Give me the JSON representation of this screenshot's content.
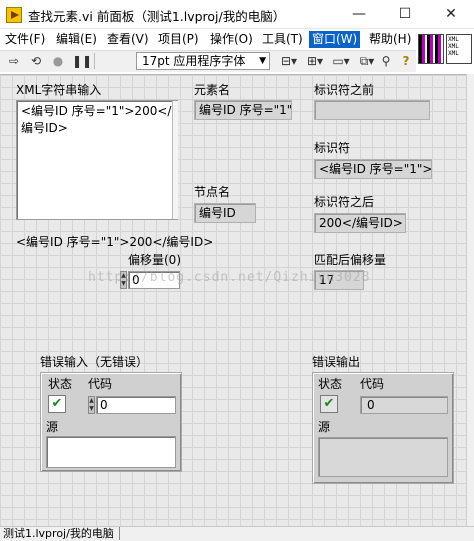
{
  "window": {
    "title": "查找元素.vi 前面板（测试1.lvproj/我的电脑）",
    "minimize": "—",
    "maximize": "☐",
    "close": "✕"
  },
  "menu": {
    "file": "文件(F)",
    "edit": "编辑(E)",
    "view": "查看(V)",
    "project": "项目(P)",
    "operate": "操作(O)",
    "tools": "工具(T)",
    "window": "窗口(W)",
    "help": "帮助(H)"
  },
  "toolbar": {
    "font": "17pt 应用程序字体",
    "help_icon": "?"
  },
  "connector": {
    "lines": [
      "XML",
      "XML",
      "XML"
    ]
  },
  "panel": {
    "xml_input_label": "XML字符串输入",
    "xml_input_value": "<编号ID 序号=\"1\">200</\n编号ID>",
    "free_text": "<编号ID 序号=\"1\">200</编号ID>",
    "element_name_label": "元素名",
    "element_name_value": "编号ID 序号=\"1\"",
    "node_name_label": "节点名",
    "node_name_value": "编号ID",
    "offset_label": "偏移量(0)",
    "offset_value": "0",
    "tag_before_label": "标识符之前",
    "tag_before_value": "",
    "tag_label": "标识符",
    "tag_value": "<编号ID 序号=\"1\">",
    "tag_after_label": "标识符之后",
    "tag_after_value": "200</编号ID>",
    "match_offset_label": "匹配后偏移量",
    "match_offset_value": "17",
    "error_in": {
      "label": "错误输入（无错误）",
      "status_label": "状态",
      "code_label": "代码",
      "code_value": "0",
      "source_label": "源"
    },
    "error_out": {
      "label": "错误输出",
      "status_label": "状态",
      "code_label": "代码",
      "code_value": "0",
      "source_label": "源"
    },
    "watermark": "http://blog.csdn.net/Qizhiyu3028"
  },
  "status": {
    "context": "测试1.lvproj/我的电脑"
  },
  "colors": {
    "menu_active": "#0a64c8",
    "panel_bg": "#e9e9e9",
    "check_green": "#1a8a1a"
  }
}
